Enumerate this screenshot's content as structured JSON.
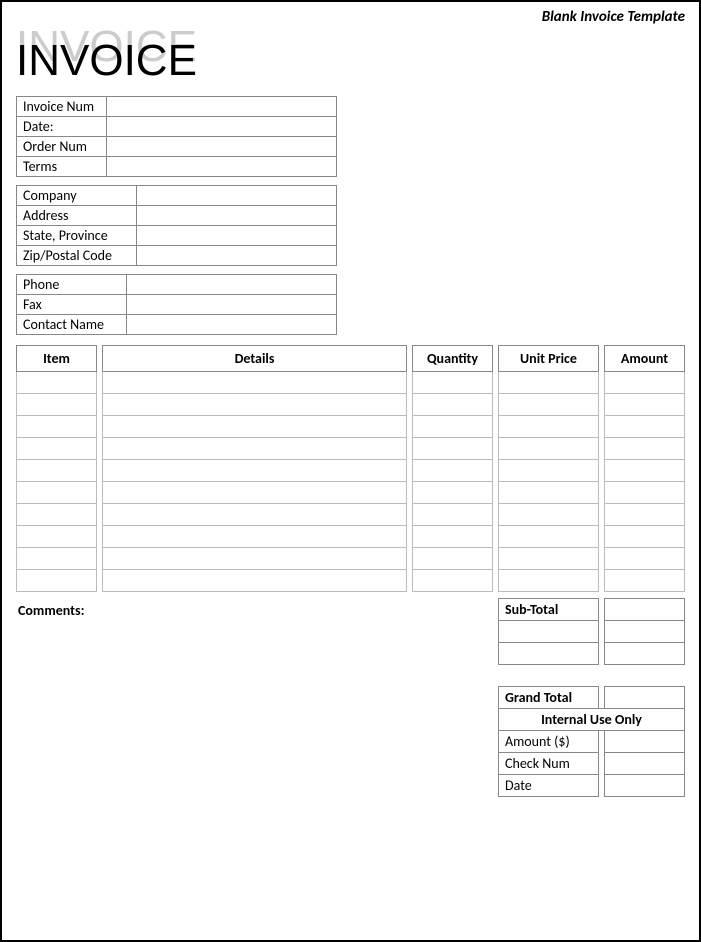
{
  "header_label": "Blank Invoice Template",
  "logo_text": "INVOICE",
  "info1": {
    "invoice_num_label": "Invoice Num",
    "invoice_num_value": "",
    "date_label": "Date:",
    "date_value": "",
    "order_num_label": "Order Num",
    "order_num_value": "",
    "terms_label": "Terms",
    "terms_value": ""
  },
  "info2": {
    "company_label": "Company",
    "company_value": "",
    "address_label": "Address",
    "address_value": "",
    "state_label": "State, Province",
    "state_value": "",
    "zip_label": "Zip/Postal Code",
    "zip_value": ""
  },
  "info3": {
    "phone_label": "Phone",
    "phone_value": "",
    "fax_label": "Fax",
    "fax_value": "",
    "contact_label": "Contact Name",
    "contact_value": ""
  },
  "columns": {
    "item": "Item",
    "details": "Details",
    "quantity": "Quantity",
    "unit_price": "Unit Price",
    "amount": "Amount"
  },
  "rows": [
    {
      "item": "",
      "details": "",
      "quantity": "",
      "unit_price": "",
      "amount": ""
    },
    {
      "item": "",
      "details": "",
      "quantity": "",
      "unit_price": "",
      "amount": ""
    },
    {
      "item": "",
      "details": "",
      "quantity": "",
      "unit_price": "",
      "amount": ""
    },
    {
      "item": "",
      "details": "",
      "quantity": "",
      "unit_price": "",
      "amount": ""
    },
    {
      "item": "",
      "details": "",
      "quantity": "",
      "unit_price": "",
      "amount": ""
    },
    {
      "item": "",
      "details": "",
      "quantity": "",
      "unit_price": "",
      "amount": ""
    },
    {
      "item": "",
      "details": "",
      "quantity": "",
      "unit_price": "",
      "amount": ""
    },
    {
      "item": "",
      "details": "",
      "quantity": "",
      "unit_price": "",
      "amount": ""
    },
    {
      "item": "",
      "details": "",
      "quantity": "",
      "unit_price": "",
      "amount": ""
    },
    {
      "item": "",
      "details": "",
      "quantity": "",
      "unit_price": "",
      "amount": ""
    }
  ],
  "comments_label": "Comments:",
  "totals": {
    "subtotal_label": "Sub-Total",
    "subtotal_value": "",
    "extra1_label": "",
    "extra1_value": "",
    "extra2_label": "",
    "extra2_value": "",
    "grand_total_label": "Grand Total",
    "grand_total_value": "",
    "internal_header": "Internal Use Only",
    "amount_label": "Amount ($)",
    "amount_value": "",
    "check_label": "Check Num",
    "check_value": "",
    "date_label": "Date",
    "date_value": ""
  }
}
